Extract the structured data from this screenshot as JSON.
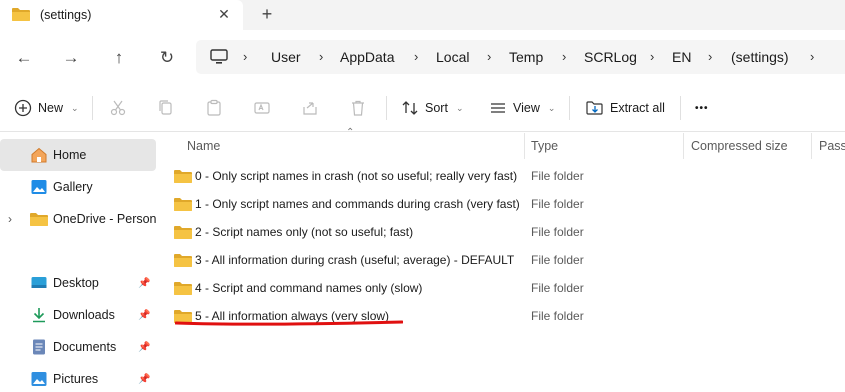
{
  "tab": {
    "title": "(settings)",
    "close": "✕",
    "new": "+"
  },
  "nav": {
    "breadcrumbs": [
      "User",
      "AppData",
      "Local",
      "Temp",
      "SCRLog",
      "EN",
      "(settings)"
    ]
  },
  "commands": {
    "new": "New",
    "sort": "Sort",
    "view": "View",
    "extract_all": "Extract all",
    "more": "•••"
  },
  "sidebar": {
    "items": [
      {
        "label": "Home",
        "icon": "home-icon"
      },
      {
        "label": "Gallery",
        "icon": "gallery-icon"
      },
      {
        "label": "OneDrive - Persona",
        "icon": "folder-icon"
      },
      {
        "label": "Desktop",
        "icon": "desktop-icon"
      },
      {
        "label": "Downloads",
        "icon": "download-icon"
      },
      {
        "label": "Documents",
        "icon": "documents-icon"
      },
      {
        "label": "Pictures",
        "icon": "pictures-icon"
      }
    ]
  },
  "columns": {
    "name": "Name",
    "type": "Type",
    "compressed_size": "Compressed size",
    "password": "Passw"
  },
  "rows": [
    {
      "name": "0 - Only script names in crash (not so useful; really very fast)",
      "type": "File folder"
    },
    {
      "name": "1 - Only script names and commands during crash (very fast)",
      "type": "File folder"
    },
    {
      "name": "2 - Script names only (not so useful; fast)",
      "type": "File folder"
    },
    {
      "name": "3 - All information during crash (useful; average) - DEFAULT",
      "type": "File folder"
    },
    {
      "name": "4 - Script and command names only (slow)",
      "type": "File folder"
    },
    {
      "name": "5 - All information always (very slow)",
      "type": "File folder"
    }
  ],
  "colors": {
    "folder": "#f5c343",
    "folder_dark": "#e0a82a",
    "annotation": "#e01010",
    "accent": "#0067c0"
  }
}
